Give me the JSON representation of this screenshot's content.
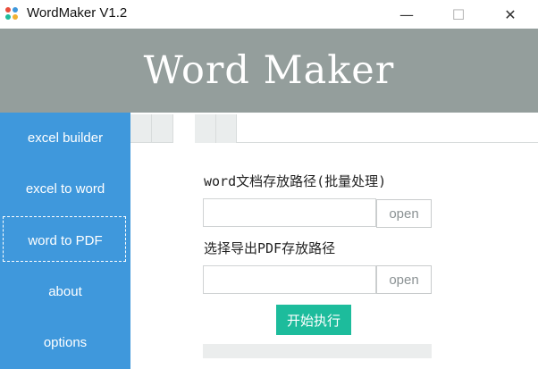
{
  "window": {
    "title": "WordMaker V1.2",
    "minimize_glyph": "—",
    "maximize_glyph": "☐",
    "close_glyph": "✕",
    "icon_name": "wordmaker-app-icon"
  },
  "header": {
    "title": "Word Maker"
  },
  "sidebar": {
    "items": [
      {
        "label": "excel builder"
      },
      {
        "label": "excel to word"
      },
      {
        "label": "word to PDF"
      },
      {
        "label": "about"
      },
      {
        "label": "options"
      }
    ],
    "active_label": "word to PDF"
  },
  "form": {
    "word_path_label": "word文档存放路径(批量处理)",
    "word_path_value": "",
    "word_open_label": "open",
    "pdf_path_label": "选择导出PDF存放路径",
    "pdf_path_value": "",
    "pdf_open_label": "open",
    "start_label": "开始执行"
  },
  "progress": {
    "value": 0
  },
  "colors": {
    "header_bg": "#949e9c",
    "sidebar_bg": "#3f98dc",
    "start_button": "#1dbc9c"
  }
}
